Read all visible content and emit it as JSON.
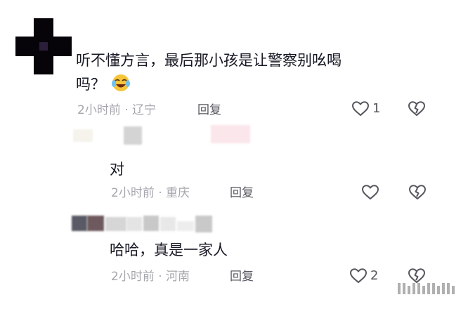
{
  "comments": [
    {
      "text_line1": "听不懂方言，最后那小孩是让警察别吆喝",
      "text_line2": "吗？",
      "emoji": "crying-laughing-emoji",
      "time": "2小时前",
      "location": "辽宁",
      "reply_label": "回复",
      "like_count": "1"
    },
    {
      "text": "对",
      "time": "2小时前",
      "location": "重庆",
      "reply_label": "回复",
      "like_count": ""
    },
    {
      "text": "哈哈，真是一家人",
      "time": "2小时前",
      "location": "河南",
      "reply_label": "回复",
      "like_count": "2"
    }
  ],
  "colors": {
    "text": "#161823",
    "meta": "#a5a7ad",
    "icon": "#55575e"
  },
  "icons": [
    "heart-icon",
    "dislike-heart-icon",
    "watermark-logo"
  ]
}
